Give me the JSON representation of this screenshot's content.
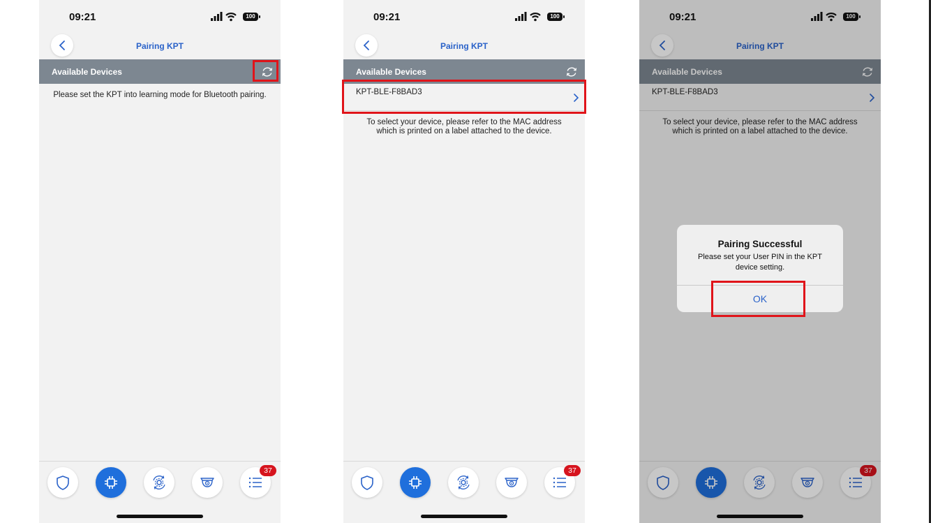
{
  "screens": [
    {
      "time": "09:21",
      "battery": "100",
      "nav_title": "Pairing KPT",
      "section_title": "Available Devices",
      "message": "Please set the KPT into learning mode for Bluetooth pairing.",
      "badge_count": "37"
    },
    {
      "time": "09:21",
      "battery": "100",
      "nav_title": "Pairing KPT",
      "section_title": "Available Devices",
      "device_name": "KPT-BLE-F8BAD3",
      "message": "To select your device, please refer to the MAC address which is printed on a label attached to the device.",
      "badge_count": "37"
    },
    {
      "time": "09:21",
      "battery": "100",
      "nav_title": "Pairing KPT",
      "section_title": "Available Devices",
      "device_name": "KPT-BLE-F8BAD3",
      "message": "To select your device, please refer to the MAC address which is printed on a label attached to the device.",
      "badge_count": "37",
      "alert": {
        "title": "Pairing Successful",
        "message": "Please set your User PIN in the KPT device setting.",
        "ok_label": "OK"
      }
    }
  ],
  "tabs": [
    "shield-icon",
    "chip-icon",
    "gear-sync-icon",
    "camera-icon",
    "list-icon"
  ],
  "colors": {
    "accent": "#1f6fdc",
    "title_blue": "#2a62c9",
    "section_bar": "#7d8791",
    "badge": "#d6141e",
    "highlight": "#e0141a"
  }
}
